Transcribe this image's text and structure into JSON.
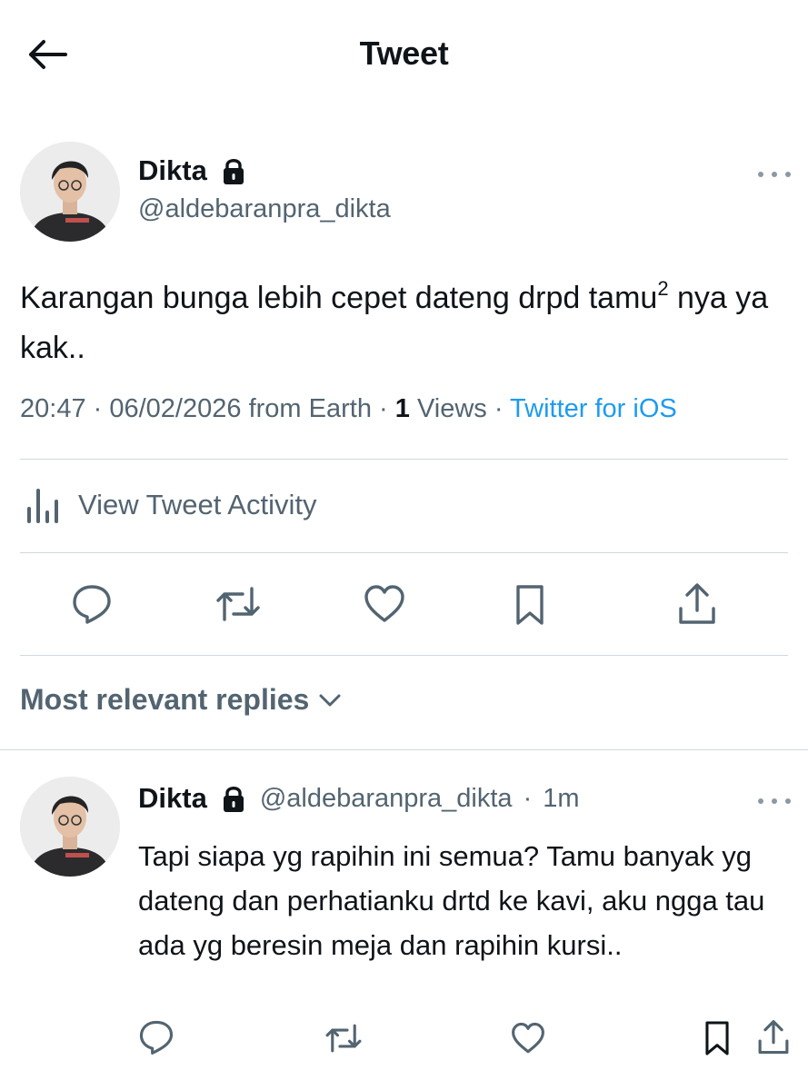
{
  "header": {
    "title": "Tweet"
  },
  "tweet": {
    "author_name": "Dikta",
    "author_handle": "@aldebaranpra_dikta",
    "text_line1": "Karangan bunga lebih cepet dateng drpd tamu",
    "text_superscript": "2",
    "text_after": " nya ya kak..",
    "time": "20:47",
    "date": "06/02/2026",
    "location": "from Earth",
    "views_count": "1",
    "views_label": "Views",
    "source": "Twitter for iOS",
    "activity_label": "View Tweet Activity"
  },
  "replies": {
    "sort_label": "Most relevant replies",
    "items": [
      {
        "author_name": "Dikta",
        "author_handle": "@aldebaranpra_dikta",
        "separator": "·",
        "time": "1m",
        "text": "Tapi siapa yg rapihin ini semua? Tamu banyak yg dateng dan perhatianku drtd ke kavi, aku ngga tau ada yg beresin meja dan rapihin kursi.."
      }
    ]
  },
  "icons": {
    "back": "arrow-left-icon",
    "lock": "lock-icon",
    "more": "more-horizontal-icon",
    "activity": "bar-chart-icon",
    "reply": "reply-icon",
    "retweet": "retweet-icon",
    "like": "heart-icon",
    "bookmark": "bookmark-icon",
    "share": "share-icon",
    "chevron": "chevron-down-icon"
  },
  "colors": {
    "text": "#0f1419",
    "secondary": "#536471",
    "link": "#1d9bf0",
    "divider": "#cfd9de"
  }
}
